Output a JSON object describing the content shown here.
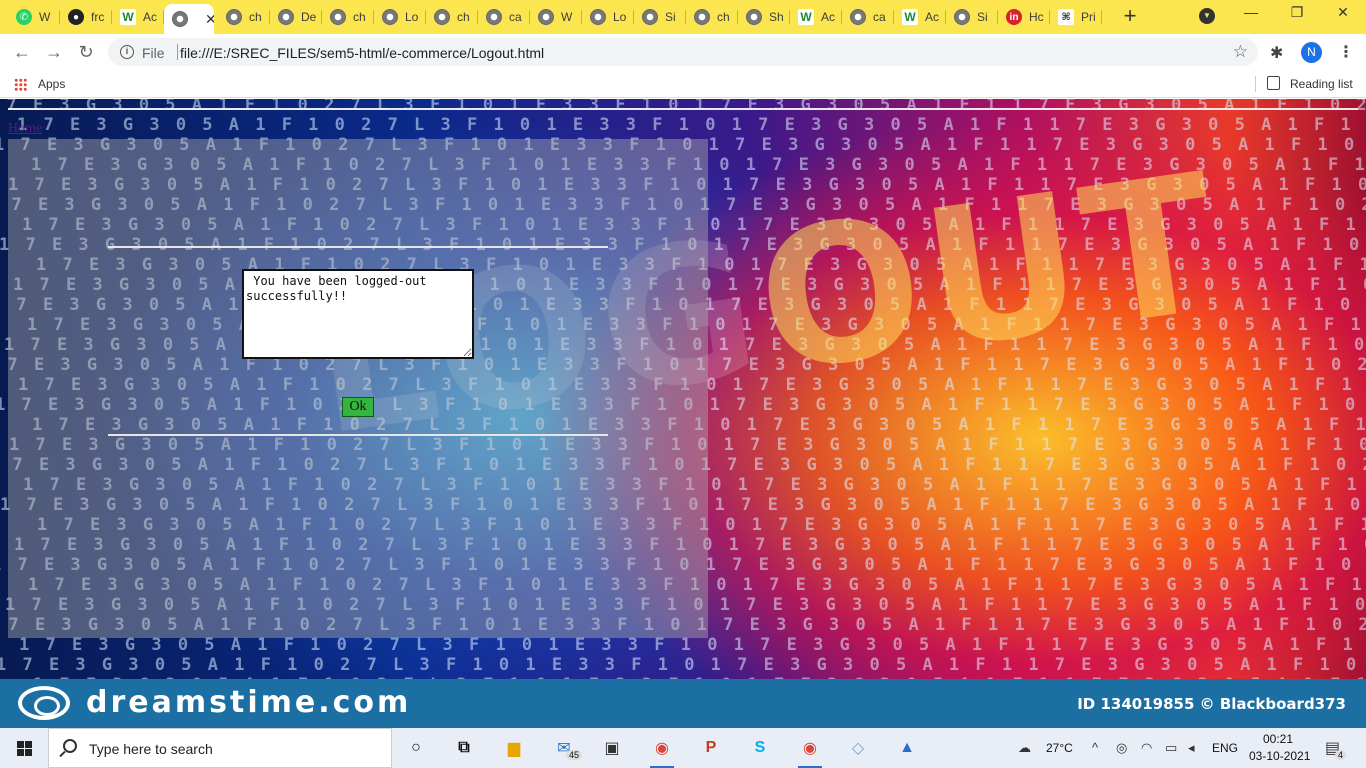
{
  "browser": {
    "tabs": [
      {
        "label": "W",
        "favicon": "whatsapp-icon"
      },
      {
        "label": "frc",
        "favicon": "github-icon"
      },
      {
        "label": "Ac",
        "favicon": "w-icon"
      },
      {
        "label": "",
        "favicon": "chrome-page-icon",
        "active": true
      },
      {
        "label": "ch",
        "favicon": "chrome-page-icon"
      },
      {
        "label": "De",
        "favicon": "chrome-page-icon"
      },
      {
        "label": "ch",
        "favicon": "chrome-page-icon"
      },
      {
        "label": "Lo",
        "favicon": "chrome-page-icon"
      },
      {
        "label": "ch",
        "favicon": "chrome-page-icon"
      },
      {
        "label": "ca",
        "favicon": "chrome-page-icon"
      },
      {
        "label": "W",
        "favicon": "chrome-page-icon"
      },
      {
        "label": "Lo",
        "favicon": "chrome-page-icon"
      },
      {
        "label": "Si",
        "favicon": "chrome-page-icon"
      },
      {
        "label": "ch",
        "favicon": "chrome-page-icon"
      },
      {
        "label": "Sh",
        "favicon": "chrome-page-icon"
      },
      {
        "label": "Ac",
        "favicon": "w-icon"
      },
      {
        "label": "ca",
        "favicon": "chrome-page-icon"
      },
      {
        "label": "Ac",
        "favicon": "w-icon"
      },
      {
        "label": "Si",
        "favicon": "chrome-page-icon"
      },
      {
        "label": "Hc",
        "favicon": "in-icon"
      },
      {
        "label": "Pri",
        "favicon": "pr-icon"
      }
    ],
    "close_glyph": "✕",
    "new_tab_glyph": "+",
    "tab_search_glyph": "▼",
    "window_controls": {
      "minimize": "—",
      "restore": "❐",
      "close": "✕"
    },
    "nav": {
      "back": "←",
      "forward": "→",
      "reload": "↻"
    },
    "address": {
      "scheme_label": "File",
      "url": "file:///E:/SREC_FILES/sem5-html/e-commerce/Logout.html",
      "info_glyph": "i",
      "star_glyph": "☆"
    },
    "extensions_glyph": "✱",
    "profile_initial": "N",
    "menu_glyph": "⋮",
    "bookmarks": {
      "apps_label": "Apps",
      "reading_list_label": "Reading list"
    }
  },
  "page": {
    "home_link": "Home",
    "message": " You have been logged-out\nsuccessfully!!",
    "ok_button": "Ok",
    "background": {
      "headline": "LOGOUT",
      "watermark_site": "dreamstime.com",
      "watermark_id": "ID 134019855 © Blackboard373"
    }
  },
  "taskbar": {
    "search_placeholder": "Type here to search",
    "mail_badge": "45",
    "weather": "27°C",
    "language": "ENG",
    "time": "00:21",
    "date": "03-10-2021",
    "notification_count": "4",
    "apps": [
      {
        "name": "cortana-icon",
        "glyph": "○"
      },
      {
        "name": "task-view-icon",
        "glyph": "⧉"
      },
      {
        "name": "file-explorer-icon",
        "glyph": "▆"
      },
      {
        "name": "mail-icon",
        "glyph": "✉"
      },
      {
        "name": "store-icon",
        "glyph": "▣"
      },
      {
        "name": "chrome-icon",
        "glyph": "◉"
      },
      {
        "name": "powerpoint-icon",
        "glyph": "P"
      },
      {
        "name": "skype-icon",
        "glyph": "S"
      },
      {
        "name": "chrome-profile-icon",
        "glyph": "◉"
      },
      {
        "name": "app-icon",
        "glyph": "◇"
      },
      {
        "name": "photos-icon",
        "glyph": "▲"
      }
    ]
  },
  "colors": {
    "tabstrip": "#fbe64f",
    "ok_button": "#33b540",
    "watermark_bar": "#1c6fa3",
    "visited_link": "#551a8b"
  }
}
